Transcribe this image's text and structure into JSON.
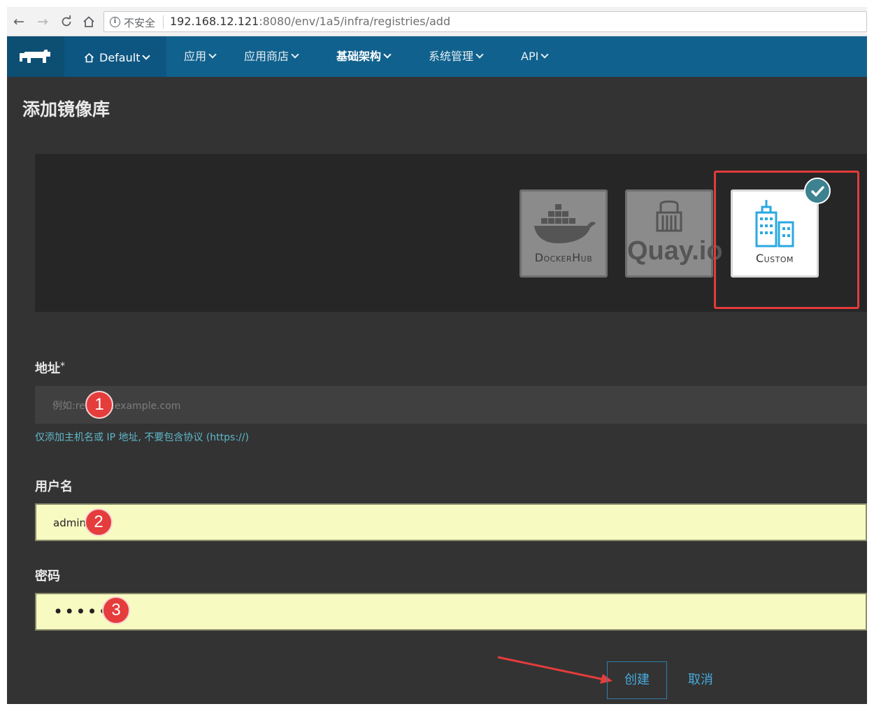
{
  "browser": {
    "insecure_label": "不安全",
    "url_host": "192.168.12.121",
    "url_rest": ":8080/env/1a5/infra/registries/add"
  },
  "header": {
    "environment": "Default",
    "menu": [
      {
        "label": "应用",
        "active": false
      },
      {
        "label": "应用商店",
        "active": false
      },
      {
        "label": "基础架构",
        "active": true
      },
      {
        "label": "系统管理",
        "active": false
      },
      {
        "label": "API",
        "active": false
      }
    ]
  },
  "page": {
    "title": "添加镜像库"
  },
  "drivers": [
    {
      "label": "DockerHub",
      "icon": "docker-whale-icon",
      "selected": false
    },
    {
      "label": "Quay.io",
      "icon": "quay-logo",
      "selected": false
    },
    {
      "label": "Custom",
      "icon": "buildings-icon",
      "selected": true
    }
  ],
  "form": {
    "address": {
      "label": "地址",
      "required_mark": "*",
      "placeholder": "例如:registry.example.com",
      "help": "仅添加主机名或 IP 地址, 不要包含协议 (https://)"
    },
    "username": {
      "label": "用户名",
      "value": "admin"
    },
    "password": {
      "label": "密码",
      "masked": "••••••"
    }
  },
  "annotations": [
    "1",
    "2",
    "3"
  ],
  "actions": {
    "create": "创建",
    "cancel": "取消"
  },
  "colors": {
    "header_bg": "#10618d",
    "page_bg": "#333333",
    "accent": "#47a9dd",
    "annotation_red": "#e53c3c",
    "autofill_yellow": "#f7fbc1"
  }
}
